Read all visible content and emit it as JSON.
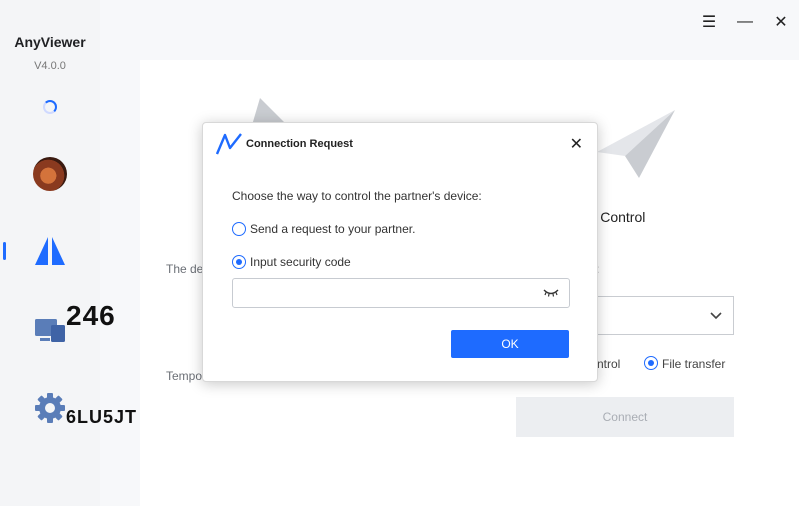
{
  "app": {
    "name": "AnyViewer",
    "version": "V4.0.0"
  },
  "window": {
    "menu_icon": "☰",
    "minimize_icon": "—",
    "close_icon": "✕"
  },
  "sidebar": {
    "items": [
      {
        "name": "profile",
        "icon": "avatar"
      },
      {
        "name": "remote-control",
        "icon": "anyviewer-logo-icon",
        "active": true
      },
      {
        "name": "devices",
        "icon": "devices-icon"
      },
      {
        "name": "settings",
        "icon": "gear-icon"
      }
    ]
  },
  "left_panel": {
    "device_id_label": "The de",
    "device_id": "246",
    "temp_code_label": "Tempo",
    "temp_code": "6LU5JT"
  },
  "right_panel": {
    "title": "art Control",
    "partner_label_tail": ":",
    "option_control_tail": "ntrol",
    "option_file_transfer": "File transfer",
    "connect_label": "Connect"
  },
  "dialog": {
    "title": "Connection Request",
    "close_icon": "✕",
    "prompt": "Choose the way to control the partner's device:",
    "options": [
      {
        "label": "Send a request to your partner.",
        "checked": false
      },
      {
        "label": "Input security code",
        "checked": true
      }
    ],
    "security_code_value": "",
    "ok_label": "OK"
  },
  "colors": {
    "accent": "#1e6bff",
    "sidebar_bg": "#f4f5f7",
    "button_disabled": "#eceef1"
  }
}
